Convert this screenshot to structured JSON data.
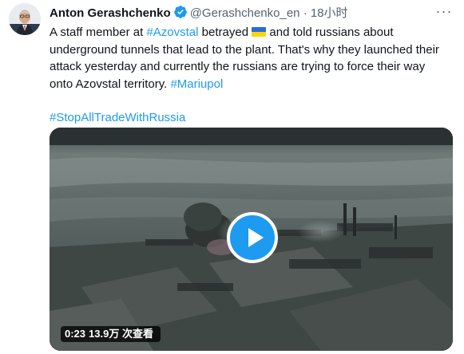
{
  "tweet": {
    "author_name": "Anton Gerashchenko",
    "handle": "@Gerashchenko_en",
    "separator": "·",
    "time": "18小时",
    "more_label": "···",
    "body": {
      "t1": "A staff member at ",
      "hashtag_azovstal": "#Azovstal",
      "t2": " betrayed ",
      "t3": " and told russians about underground tunnels that lead to the plant. That's why they launched their attack yesterday and currently the russians are trying to force their way onto Azovstal territory. ",
      "hashtag_mariupol": "#Mariupol",
      "hashtag_stop": "#StopAllTradeWithRussia"
    },
    "video": {
      "duration": "0:23",
      "views": "13.9万 次查看"
    }
  },
  "colors": {
    "accent": "#1d9bf0",
    "text": "#0f1419",
    "muted": "#536471"
  },
  "icons": [
    "verified-badge-icon",
    "ukraine-flag-icon",
    "more-options-icon",
    "play-icon"
  ]
}
